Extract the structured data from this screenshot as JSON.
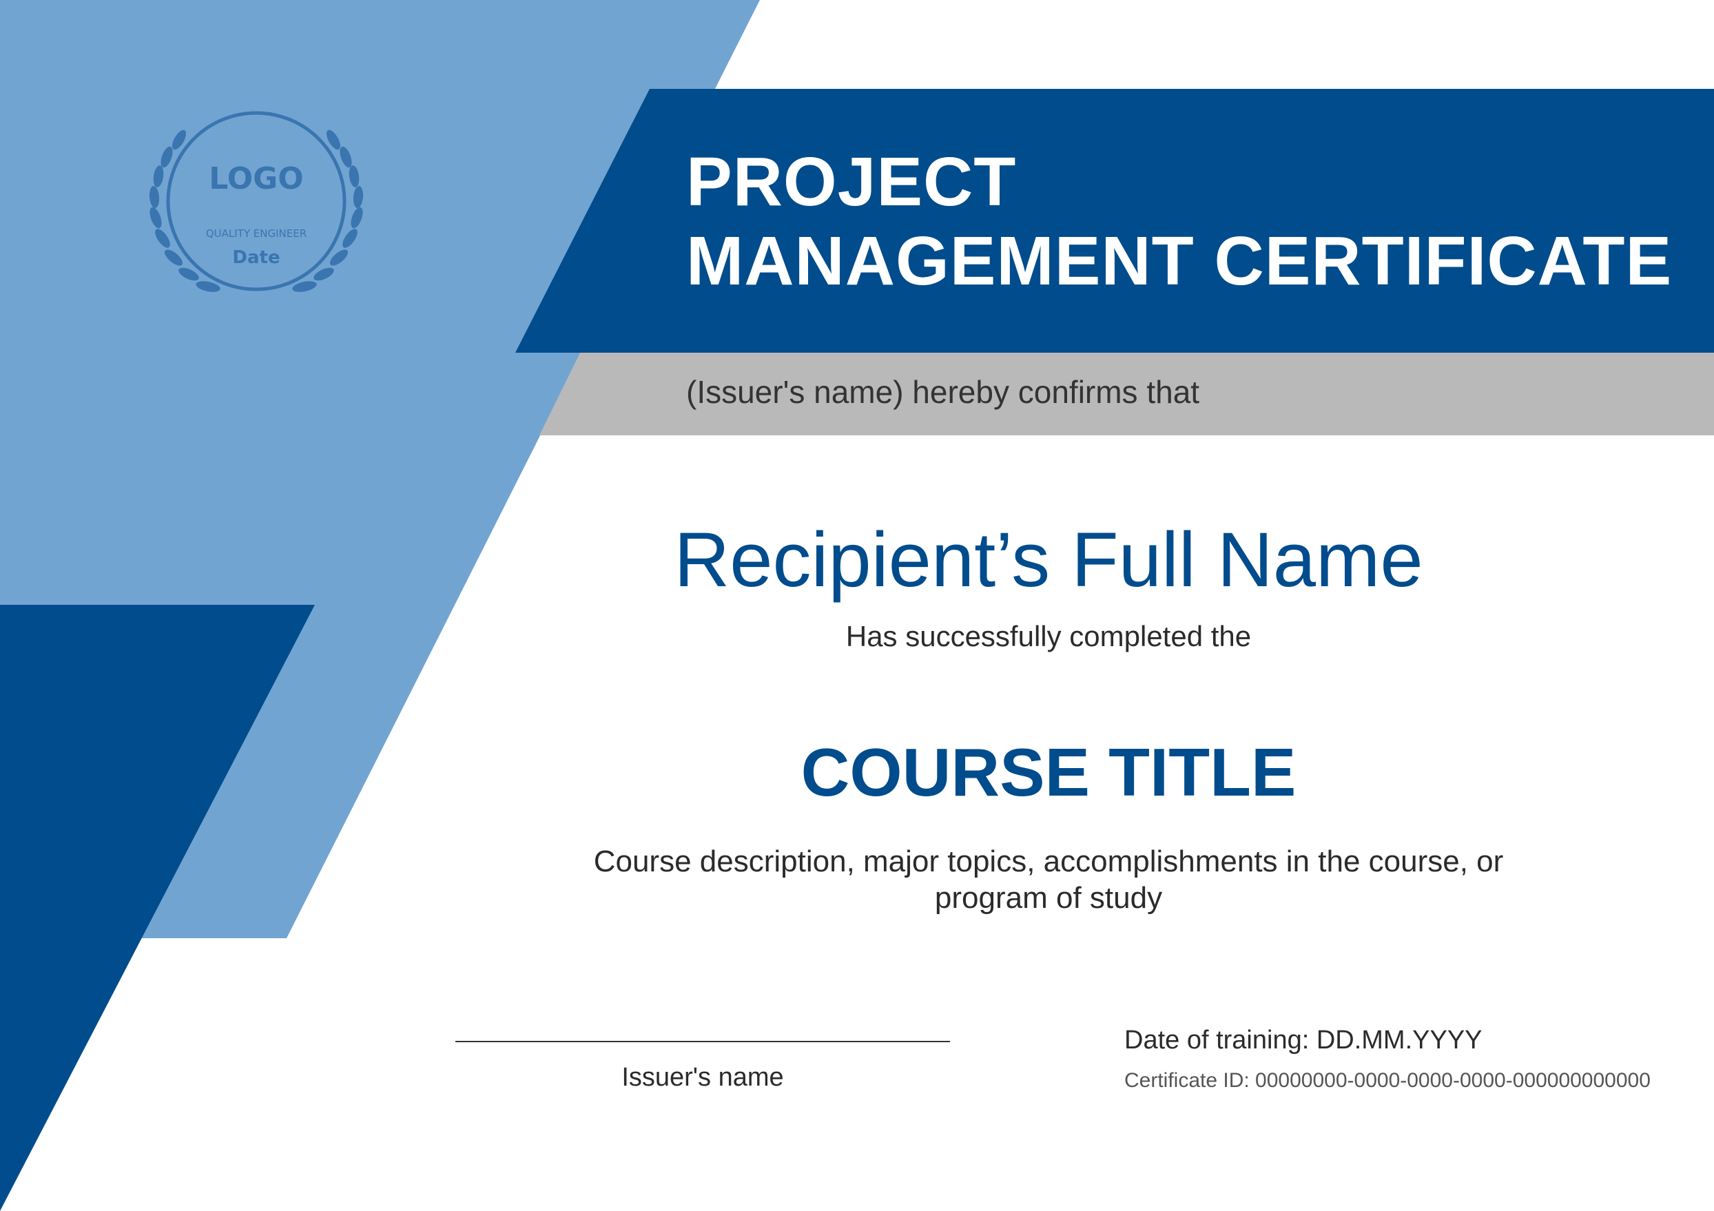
{
  "certificate": {
    "title_line1": "PROJECT",
    "title_line2": "MANAGEMENT CERTIFICATE",
    "issuer_confirms": "(Issuer's name) hereby confirms that",
    "recipient_name": "Recipient’s Full Name",
    "completed_text": "Has successfully completed the",
    "course_title": "COURSE TITLE",
    "course_description": "Course description, major topics, accomplishments in the course, or program of study",
    "issuer_signature_label": "Issuer's name",
    "date_of_training": "Date of training: DD.MM.YYYY",
    "certificate_id": "Certificate ID: 00000000-0000-0000-0000-000000000000"
  },
  "logo": {
    "text": "LOGO",
    "subtitle": "QUALITY ENGINEER",
    "date": "Date",
    "icon": "laurel-wreath-icon"
  },
  "colors": {
    "dark_blue": "#004c8c",
    "light_blue": "#72a4d2",
    "gray_band": "#b9b9b9",
    "logo_blue": "#3a75b0"
  }
}
